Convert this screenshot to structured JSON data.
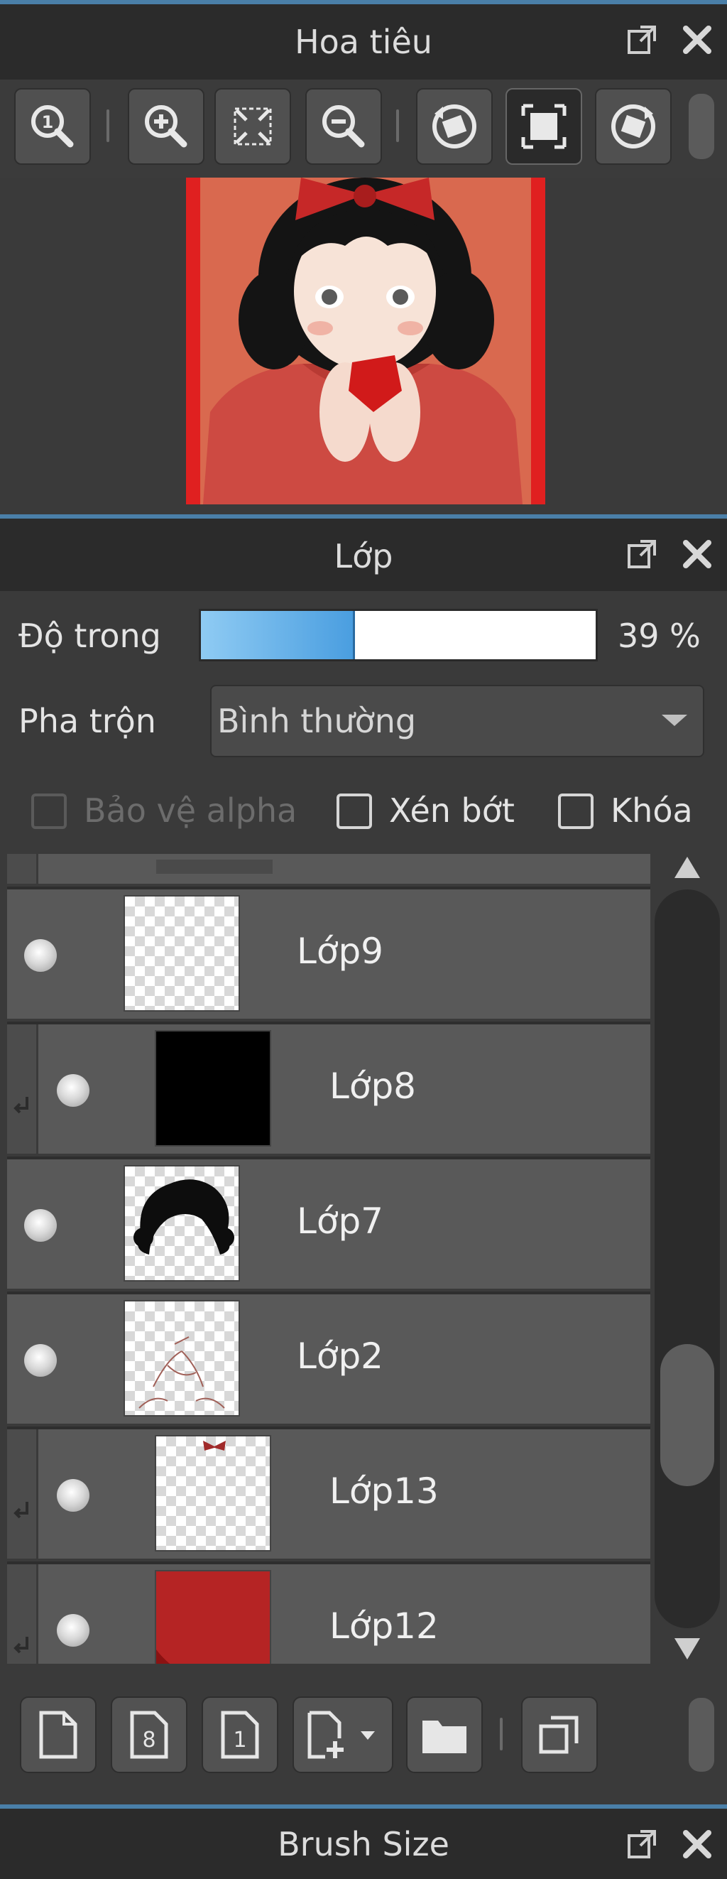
{
  "navigator": {
    "title": "Hoa tiêu",
    "toolbar": {
      "items": [
        {
          "icon": "zoom-actual-size-icon"
        },
        {
          "icon": "zoom-in-icon"
        },
        {
          "icon": "fit-screen-icon"
        },
        {
          "icon": "zoom-out-icon"
        },
        {
          "icon": "rotate-left-icon"
        },
        {
          "icon": "fit-frame-icon"
        },
        {
          "icon": "rotate-right-icon"
        }
      ]
    }
  },
  "layers": {
    "title": "Lớp",
    "opacity_label": "Độ trong",
    "opacity_value": "39 %",
    "opacity_fraction": 0.39,
    "blend_label": "Pha trộn",
    "blend_value": "Bình thường",
    "protect_alpha_label": "Bảo vệ alpha",
    "clip_label": "Xén bớt",
    "lock_label": "Khóa",
    "list": [
      {
        "name": "Lớp9",
        "clipped": false
      },
      {
        "name": "Lớp8",
        "clipped": true
      },
      {
        "name": "Lớp7",
        "clipped": false
      },
      {
        "name": "Lớp2",
        "clipped": false
      },
      {
        "name": "Lớp13",
        "clipped": true
      },
      {
        "name": "Lớp12",
        "clipped": true
      }
    ],
    "toolbar": {
      "items": [
        {
          "icon": "new-layer-icon"
        },
        {
          "icon": "new-8bit-layer-icon"
        },
        {
          "icon": "new-1bit-layer-icon"
        },
        {
          "icon": "add-layer-dropdown-icon"
        },
        {
          "icon": "folder-icon"
        },
        {
          "icon": "duplicate-layer-icon"
        }
      ]
    }
  },
  "brush_size": {
    "title": "Brush Size"
  },
  "colors": {
    "accent": "#4a7fa8",
    "canvas_border": "#e02020",
    "canvas_bg": "#d9694f"
  }
}
